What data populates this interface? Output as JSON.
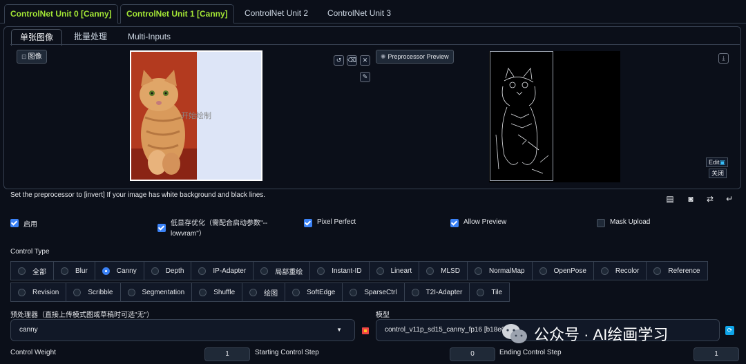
{
  "unit_tabs": [
    "ControlNet Unit 0 [Canny]",
    "ControlNet Unit 1 [Canny]",
    "ControlNet Unit 2",
    "ControlNet Unit 3"
  ],
  "sub_tabs": [
    "单张图像",
    "批量处理",
    "Multi-Inputs"
  ],
  "image_label": "图像",
  "canvas_hint": "开始绘制",
  "preprocessor_preview_label": "Preprocessor Preview",
  "edit_label": "Edit",
  "close_label": "关闭",
  "hint": "Set the preprocessor to [invert] If your image has white background and black lines.",
  "checkboxes": {
    "enable": {
      "label": "启用",
      "checked": true
    },
    "low_vram": {
      "label": "低显存优化（需配合启动参数\"--lowvram\"）",
      "checked": true
    },
    "pixel_perfect": {
      "label": "Pixel Perfect",
      "checked": true
    },
    "allow_preview": {
      "label": "Allow Preview",
      "checked": true
    },
    "mask_upload": {
      "label": "Mask Upload",
      "checked": false
    }
  },
  "control_type_label": "Control Type",
  "control_types_row1": [
    "全部",
    "Blur",
    "Canny",
    "Depth",
    "IP-Adapter",
    "局部重绘",
    "Instant-ID",
    "Lineart",
    "MLSD",
    "NormalMap",
    "OpenPose",
    "Recolor",
    "Reference"
  ],
  "control_types_row2": [
    "Revision",
    "Scribble",
    "Segmentation",
    "Shuffle",
    "绘图",
    "SoftEdge",
    "SparseCtrl",
    "T2I-Adapter",
    "Tile"
  ],
  "selected_control_type": "Canny",
  "preprocessor_label": "预处理器（直接上传模式图或草稿时可选\"无\"）",
  "preprocessor_value": "canny",
  "model_label": "模型",
  "model_value": "control_v11p_sd15_canny_fp16 [b18e0966]",
  "control_weight_label": "Control Weight",
  "control_weight_value": "1",
  "starting_step_label": "Starting Control Step",
  "starting_step_value": "0",
  "ending_step_label": "Ending Control Step",
  "ending_step_value": "1",
  "watermark": "公众号 · AI绘画学习",
  "icons": {
    "reset": "reset-icon",
    "eraser": "eraser-icon",
    "clear": "close-icon",
    "brush": "brush-icon",
    "download": "download-icon",
    "note": "note-icon",
    "camera": "camera-icon",
    "swap": "swap-icon",
    "send": "send-icon",
    "refresh": "refresh-icon"
  },
  "colors": {
    "accent_green": "#a3e635",
    "accent_blue": "#3b82f6",
    "background": "#0b0f19"
  }
}
